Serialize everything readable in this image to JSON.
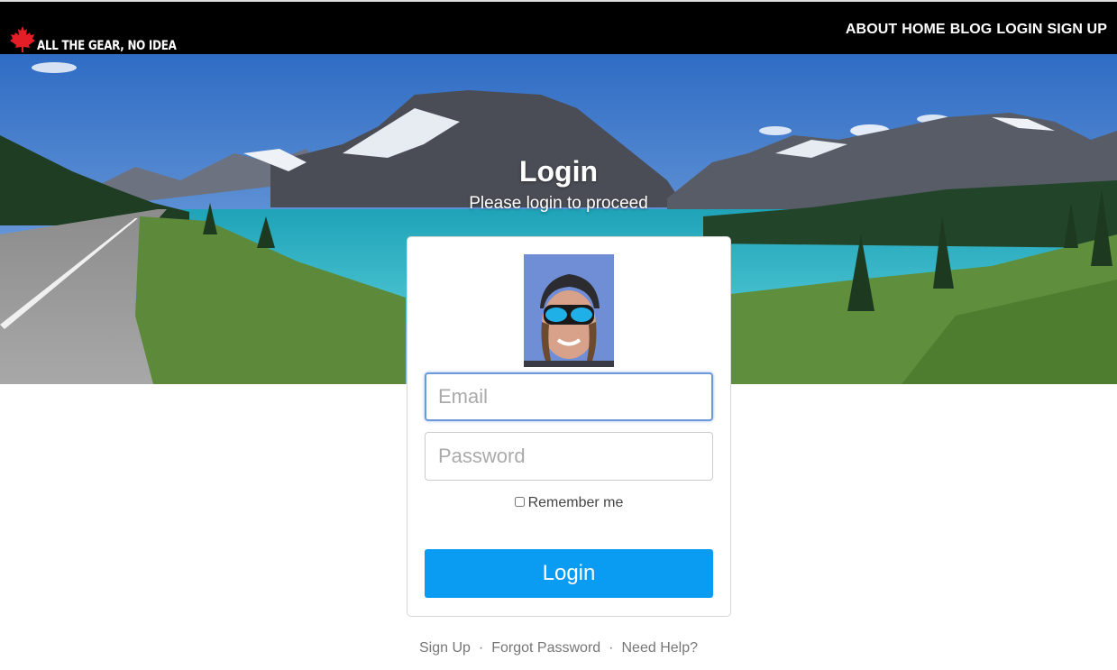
{
  "header": {
    "logo_text": "ALL THE GEAR, NO IDEA",
    "nav": [
      "ABOUT",
      "HOME",
      "BLOG",
      "LOGIN",
      "SIGN UP"
    ]
  },
  "hero": {
    "title": "Login",
    "subtitle": "Please login to proceed"
  },
  "form": {
    "email_placeholder": "Email",
    "password_placeholder": "Password",
    "remember_label": "Remember me",
    "login_button": "Login"
  },
  "footer": {
    "links": [
      "Sign Up",
      "Forgot Password",
      "Need Help?"
    ],
    "separator": "·"
  },
  "colors": {
    "topbar": "#000000",
    "button": "#0a9bf2",
    "focus_border": "#6d99d8"
  }
}
